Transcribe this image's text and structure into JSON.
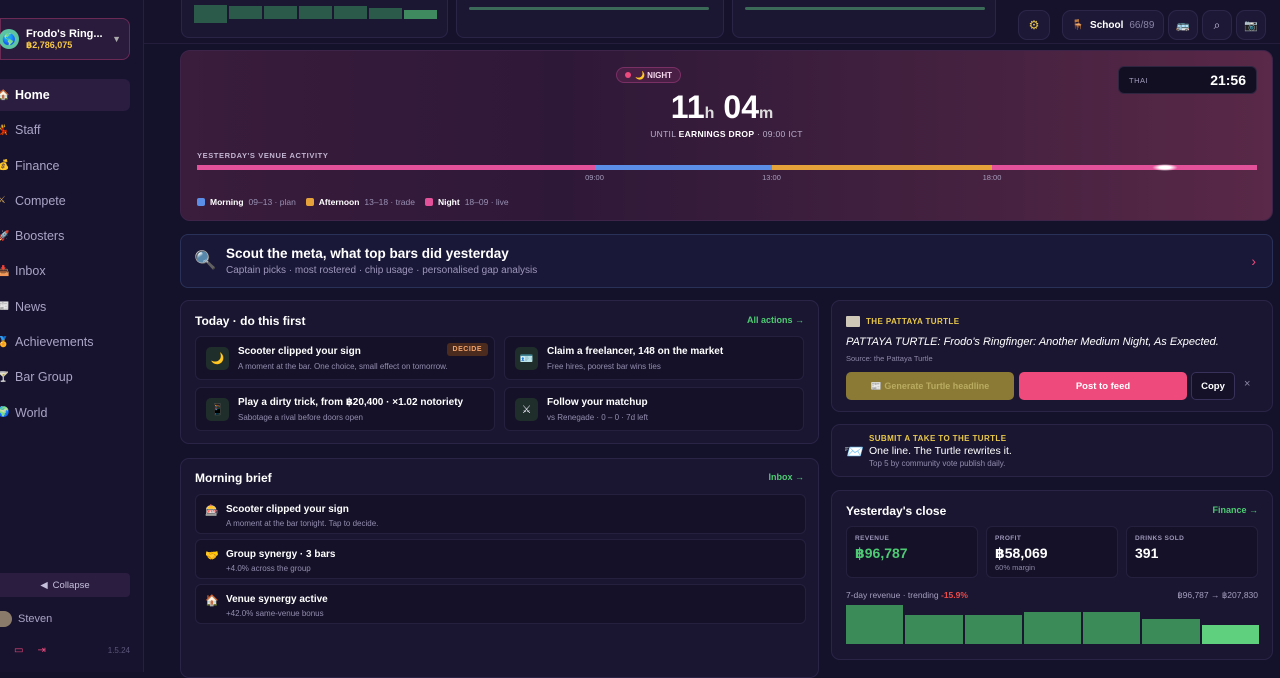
{
  "sidebar": {
    "bar_name": "Frodo's Ring...",
    "bar_balance": "฿2,786,075",
    "items": [
      {
        "label": "Home",
        "icon": "🏠",
        "active": true
      },
      {
        "label": "Staff",
        "icon": "💃"
      },
      {
        "label": "Finance",
        "icon": "💰"
      },
      {
        "label": "Compete",
        "icon": "⚔"
      },
      {
        "label": "Boosters",
        "icon": "🚀"
      },
      {
        "label": "Inbox",
        "icon": "📥"
      },
      {
        "label": "News",
        "icon": "📰"
      },
      {
        "label": "Achievements",
        "icon": "🏅"
      },
      {
        "label": "Bar Group",
        "icon": "🍸"
      },
      {
        "label": "World",
        "icon": "🌍"
      }
    ],
    "collapse_label": "Collapse",
    "user_name": "Steven",
    "version": "1.5.24"
  },
  "topbar": {
    "school_label": "School",
    "school_count": "66/89"
  },
  "hero": {
    "phase_label": "🌙 NIGHT",
    "hours": "11",
    "hours_unit": "h",
    "minutes": "04",
    "minutes_unit": "m",
    "until_prefix": "UNTIL",
    "until_bold": "EARNINGS DROP",
    "until_suffix": "· 09:00 ICT",
    "clock_zone": "THAI",
    "clock_time": "21:56",
    "activity_label": "YESTERDAY'S VENUE ACTIVITY",
    "ticks": [
      "09:00",
      "13:00",
      "18:00"
    ],
    "legend": [
      {
        "name": "Morning",
        "detail": "09–13 · plan",
        "color": "#5b8ee6"
      },
      {
        "name": "Afternoon",
        "detail": "13–18 · trade",
        "color": "#e5a23a"
      },
      {
        "name": "Night",
        "detail": "18–09 · live",
        "color": "#e2519a"
      }
    ]
  },
  "scout": {
    "title": "Scout the meta, what top bars did yesterday",
    "subtitle": "Captain picks · most rostered · chip usage · personalised gap analysis"
  },
  "today": {
    "title": "Today · do this first",
    "link": "All actions →",
    "tasks": [
      {
        "icon": "🌙",
        "title": "Scooter clipped your sign",
        "sub": "A moment at the bar. One choice, small effect on tomorrow.",
        "badge": "DECIDE"
      },
      {
        "icon": "🪪",
        "title": "Claim a freelancer, 148 on the market",
        "sub": "Free hires, poorest bar wins ties"
      },
      {
        "icon": "📱",
        "title": "Play a dirty trick, from ฿20,400 · ×1.02 notoriety",
        "sub": "Sabotage a rival before doors open"
      },
      {
        "icon": "⚔",
        "title": "Follow your matchup",
        "sub": "vs Renegade · 0 – 0 · 7d left"
      }
    ]
  },
  "brief": {
    "title": "Morning brief",
    "link": "Inbox →",
    "items": [
      {
        "icon": "🎰",
        "title": "Scooter clipped your sign",
        "sub": "A moment at the bar tonight. Tap to decide."
      },
      {
        "icon": "🤝",
        "title": "Group synergy · 3 bars",
        "sub": "+4.0% across the group"
      },
      {
        "icon": "🏠",
        "title": "Venue synergy active",
        "sub": "+42.0% same-venue bonus"
      }
    ]
  },
  "turtle": {
    "tag": "THE PATTAYA TURTLE",
    "headline": "PATTAYA TURTLE: Frodo's Ringfinger: Another Medium Night, As Expected.",
    "source": "Source: the Pattaya Turtle",
    "generate_label": "📰 Generate Turtle headline",
    "post_label": "Post to feed",
    "copy_label": "Copy",
    "close_label": "×"
  },
  "take": {
    "tag": "SUBMIT A TAKE TO THE TURTLE",
    "line": "One line. The Turtle rewrites it.",
    "sub": "Top 5 by community vote publish daily."
  },
  "close": {
    "title": "Yesterday's close",
    "link": "Finance →",
    "stats": [
      {
        "label": "REVENUE",
        "value": "฿96,787",
        "note": ""
      },
      {
        "label": "PROFIT",
        "value": "฿58,069",
        "note": "60% margin"
      },
      {
        "label": "DRINKS SOLD",
        "value": "391",
        "note": ""
      }
    ],
    "trend_label": "7-day revenue · trending",
    "trend_value": "-15.9%",
    "range_label": "฿96,787 → ฿207,830"
  },
  "chart_data": {
    "type": "bar",
    "values": [
      0.98,
      0.72,
      0.72,
      0.8,
      0.8,
      0.62,
      0.47
    ],
    "colors": [
      "#3b8b58",
      "#3b8b58",
      "#3b8b58",
      "#3b8b58",
      "#3b8b58",
      "#3b8b58",
      "#5fd07e"
    ]
  },
  "timeline_data": {
    "segments": [
      {
        "from": 0,
        "to": 0.375,
        "color": "#e2519a"
      },
      {
        "from": 0.375,
        "to": 0.542,
        "color": "#5b8ee6"
      },
      {
        "from": 0.542,
        "to": 0.75,
        "color": "#e5a23a"
      },
      {
        "from": 0.75,
        "to": 1,
        "color": "#e2519a"
      }
    ]
  }
}
